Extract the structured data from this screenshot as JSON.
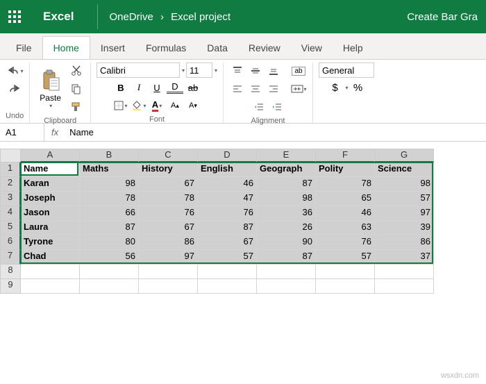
{
  "title_bar": {
    "app_name": "Excel",
    "breadcrumb_folder": "OneDrive",
    "breadcrumb_project": "Excel project",
    "doc_title": "Create Bar Gra"
  },
  "tabs": [
    "File",
    "Home",
    "Insert",
    "Formulas",
    "Data",
    "Review",
    "View",
    "Help"
  ],
  "active_tab": "Home",
  "ribbon": {
    "groups": [
      "Undo",
      "Clipboard",
      "Font",
      "Alignment",
      ""
    ],
    "paste_label": "Paste",
    "font_name": "Calibri",
    "font_size": "11",
    "bold": "B",
    "italic": "I",
    "underline": "U",
    "double_underline": "D",
    "strike": "ab",
    "wrap": "ab",
    "number_format": "General",
    "currency": "$",
    "percent": "%"
  },
  "formula_bar": {
    "name_box": "A1",
    "fx": "fx",
    "content": "Name"
  },
  "columns": [
    "A",
    "B",
    "C",
    "D",
    "E",
    "F",
    "G"
  ],
  "row_numbers": [
    "1",
    "2",
    "3",
    "4",
    "5",
    "6",
    "7",
    "8",
    "9"
  ],
  "headers": [
    "Name",
    "Maths",
    "History",
    "English",
    "Geograph",
    "Polity",
    "Science"
  ],
  "data": [
    [
      "Karan",
      98,
      67,
      46,
      87,
      78,
      98
    ],
    [
      "Joseph",
      78,
      78,
      47,
      98,
      65,
      57
    ],
    [
      "Jason",
      66,
      76,
      76,
      36,
      46,
      97
    ],
    [
      "Laura",
      87,
      67,
      87,
      26,
      63,
      39
    ],
    [
      "Tyrone",
      80,
      86,
      67,
      90,
      76,
      86
    ],
    [
      "Chad",
      56,
      97,
      57,
      87,
      57,
      37
    ]
  ],
  "watermark": "wsxdn.com"
}
